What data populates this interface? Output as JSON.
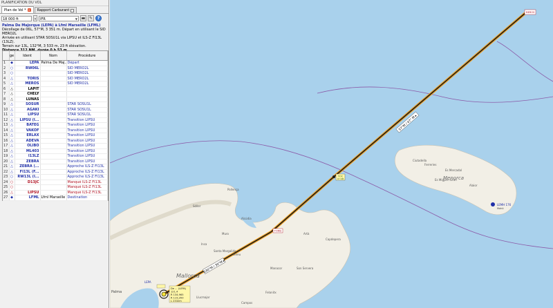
{
  "window": {
    "title": "PLANIFICATION DU VOL"
  },
  "tabs": [
    {
      "label": "Plan de Vol *",
      "active": true
    },
    {
      "label": "Rapport Carburant",
      "active": false
    }
  ],
  "toolbar": {
    "altitude_value": "18 000 ft",
    "flight_rules_value": "IFR",
    "help_label": "?"
  },
  "summary": {
    "route": "Palma De Majorque (LEPA) à Lfml Marseille (LFML)",
    "line1": "Décollage de 06L, 57°M, 3 351 m. Départ en utilisant le SID MERO2L",
    "line2": "Arrivée en utilisant STAR SOSU1L via LIPSU et ILS-Z FI13L (13LZ).",
    "line3": "Terrain sur 13L, 132°M, 3 533 m, 23 ft élévation.",
    "line4": "Distance 312 NM, durée 0 h 53 m."
  },
  "table": {
    "headers": [
      "ge",
      "Ident",
      "Nom",
      "Procédure"
    ],
    "rows": [
      {
        "n": "1",
        "icon": "◆",
        "ident": "LEPA",
        "nom": "Palma De Maj...",
        "proc": "Départ",
        "c": "blue"
      },
      {
        "n": "2",
        "icon": "○",
        "ident": "RW06L",
        "nom": "",
        "proc": "SID MERO2L",
        "c": "blue"
      },
      {
        "n": "3",
        "icon": "○",
        "ident": "",
        "nom": "",
        "proc": "SID MERO2L",
        "c": "blue"
      },
      {
        "n": "4",
        "icon": "△",
        "ident": "TORIS",
        "nom": "",
        "proc": "SID MERO2L",
        "c": "blue"
      },
      {
        "n": "5",
        "icon": "△",
        "ident": "MEROS",
        "nom": "",
        "proc": "SID MERO2L",
        "c": "blue"
      },
      {
        "n": "6",
        "icon": "△",
        "ident": "LAPIT",
        "nom": "",
        "proc": "",
        "c": ""
      },
      {
        "n": "7",
        "icon": "△",
        "ident": "CHELY",
        "nom": "",
        "proc": "",
        "c": ""
      },
      {
        "n": "8",
        "icon": "△",
        "ident": "LUNAS",
        "nom": "",
        "proc": "",
        "c": ""
      },
      {
        "n": "9",
        "icon": "△",
        "ident": "SOSUR",
        "nom": "",
        "proc": "STAR SOSU1L",
        "c": "blue"
      },
      {
        "n": "10",
        "icon": "△",
        "ident": "AGAKI",
        "nom": "",
        "proc": "STAR SOSU1L",
        "c": "blue"
      },
      {
        "n": "11",
        "icon": "△",
        "ident": "LIPSU",
        "nom": "",
        "proc": "STAR SOSU1L",
        "c": "blue"
      },
      {
        "n": "12",
        "icon": "△",
        "ident": "LIPSU (I...",
        "nom": "",
        "proc": "Transition LIPSU",
        "c": "blue"
      },
      {
        "n": "13",
        "icon": "△",
        "ident": "BATEG",
        "nom": "",
        "proc": "Transition LIPSU",
        "c": "blue"
      },
      {
        "n": "14",
        "icon": "△",
        "ident": "VAKOF",
        "nom": "",
        "proc": "Transition LIPSU",
        "c": "blue"
      },
      {
        "n": "15",
        "icon": "△",
        "ident": "ERLAX",
        "nom": "",
        "proc": "Transition LIPSU",
        "c": "blue"
      },
      {
        "n": "16",
        "icon": "△",
        "ident": "ADEVA",
        "nom": "",
        "proc": "Transition LIPSU",
        "c": "blue"
      },
      {
        "n": "17",
        "icon": "△",
        "ident": "OLIBO",
        "nom": "",
        "proc": "Transition LIPSU",
        "c": "blue"
      },
      {
        "n": "18",
        "icon": "△",
        "ident": "ML403",
        "nom": "",
        "proc": "Transition LIPSU",
        "c": "blue"
      },
      {
        "n": "19",
        "icon": "△",
        "ident": "I13LZ",
        "nom": "",
        "proc": "Transition LIPSU",
        "c": "blue"
      },
      {
        "n": "20",
        "icon": "△",
        "ident": "ZEBRA",
        "nom": "",
        "proc": "Transition LIPSU",
        "c": "blue"
      },
      {
        "n": "21",
        "icon": "△",
        "ident": "ZEBRA (...",
        "nom": "",
        "proc": "Approche ILS-Z FI13L",
        "c": "blue"
      },
      {
        "n": "22",
        "icon": "△",
        "ident": "FI13L (F...",
        "nom": "",
        "proc": "Approche ILS-Z FI13L",
        "c": "blue"
      },
      {
        "n": "23",
        "icon": "○",
        "ident": "RW13L (I...",
        "nom": "",
        "proc": "Approche ILS-Z FI13L",
        "c": "blue"
      },
      {
        "n": "24",
        "icon": "○",
        "ident": "D13JC",
        "nom": "",
        "proc": "Manqué ILS-Z FI13L",
        "c": "red"
      },
      {
        "n": "25",
        "icon": "○",
        "ident": "",
        "nom": "",
        "proc": "Manqué ILS-Z FI13L",
        "c": "red"
      },
      {
        "n": "26",
        "icon": "△",
        "ident": "LIPSU",
        "nom": "",
        "proc": "Manqué ILS-Z FI13L",
        "c": "red"
      },
      {
        "n": "27",
        "icon": "◆",
        "ident": "LFML",
        "nom": "Lfml Marseille",
        "proc": "Destination",
        "c": "blue"
      }
    ]
  },
  "map": {
    "island_big": "Mallorca",
    "island_small": "Menorca",
    "route_label_lower": "030°M / 30°M ▸",
    "route_label_upper": "57°M / 47° M ▸",
    "toc_label": "TOC",
    "toc_sub": "47 NM",
    "wp_toris": "TORIS",
    "wp_meros": "MEROS",
    "lemh_label": "LEMH 176",
    "lemh_sub": "Mahó",
    "palma_label": "Palma",
    "lepa_label": "LEPA",
    "aircraft_info": [
      "De ... (LEPA)",
      "121.4",
      "R 134,965",
      "R 119,350",
      "L 2332m"
    ],
    "towns": [
      "Sóller",
      "Pollença",
      "Alcúdia",
      "Inca",
      "Manacor",
      "Felanitx",
      "Muro",
      "Sineu",
      "Santa Margalida",
      "Artà",
      "Capdepera",
      "Son Servera",
      "Llucmajor",
      "Campos",
      "Ciutadella",
      "Es Mercadal",
      "Ferreries",
      "Alaior",
      "Es Migjorn Gran"
    ],
    "colors": {
      "sea": "#a9d1ec",
      "land": "#f2efe6",
      "route": "#1b1b1b",
      "route_glow": "#f0a020",
      "fir": "#8b5aa8"
    }
  }
}
